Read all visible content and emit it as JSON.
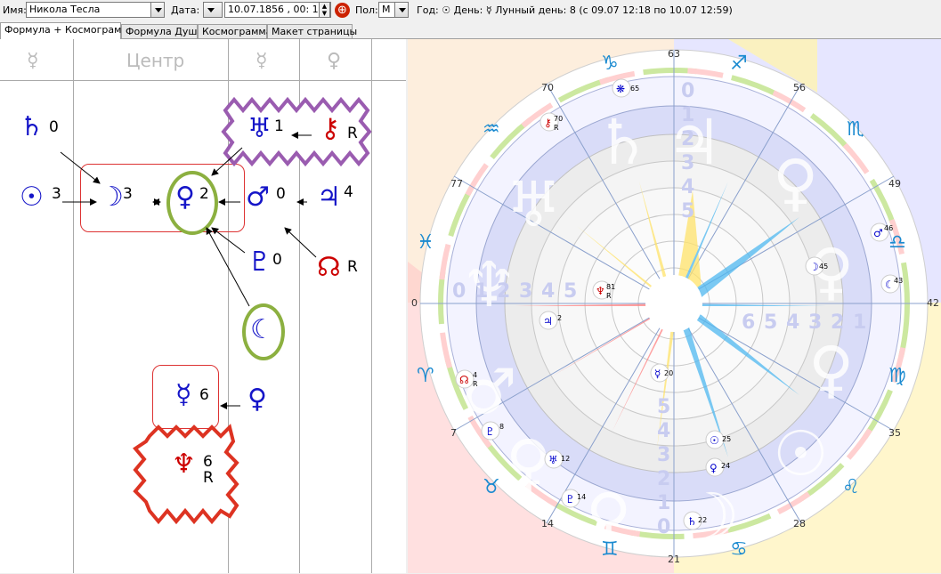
{
  "toolbar": {
    "name_label": "Имя:",
    "name_value": "Никола Тесла",
    "date_label": "Дата:",
    "date_value": "10.07.1856 , 00: 16: 17",
    "gender_label": "Пол:",
    "gender_value": "М",
    "status_text": "Год: ☉  День: ☿  Лунный день:  8 (с 09.07 12:18 по 10.07 12:59)"
  },
  "tabs": [
    "Формула + Космограмма",
    "Формула Души",
    "Космограмма",
    "Макет страницы"
  ],
  "formula": {
    "headers": [
      "☿",
      "Центр",
      "☿",
      "♀"
    ],
    "glyphs": [
      {
        "id": "saturn",
        "g": "♄",
        "n": "0"
      },
      {
        "id": "sun",
        "g": "☉",
        "n": "3"
      },
      {
        "id": "moon",
        "g": "☽",
        "n": "3"
      },
      {
        "id": "venus",
        "g": "♀",
        "n": "2"
      },
      {
        "id": "mars",
        "g": "♂",
        "n": "0"
      },
      {
        "id": "jupiter",
        "g": "♃",
        "n": "4"
      },
      {
        "id": "uranus",
        "g": "♅",
        "n": "1"
      },
      {
        "id": "chiron",
        "g": "⚷",
        "n": "R"
      },
      {
        "id": "pluto",
        "g": "♇",
        "n": "0"
      },
      {
        "id": "node",
        "g": "☊",
        "n": "R"
      },
      {
        "id": "lilith",
        "g": "☾",
        "n": ""
      },
      {
        "id": "mercury",
        "g": "☿",
        "n": "6"
      },
      {
        "id": "venus2",
        "g": "♀",
        "n": ""
      },
      {
        "id": "neptune",
        "g": "♆",
        "n": "6"
      },
      {
        "id": "neptune_r",
        "g": "",
        "n": "R"
      }
    ]
  },
  "chart": {
    "degree_labels": [
      "63",
      "56",
      "49",
      "42",
      "35",
      "28",
      "21",
      "14",
      "7",
      "0",
      "77",
      "70"
    ],
    "signs": [
      "♑",
      "♐",
      "♏",
      "♎",
      "♍",
      "♌",
      "♋",
      "♊",
      "♉",
      "♈",
      "♓",
      "♒"
    ],
    "planets": [
      {
        "g": "⚷",
        "n": "70 R",
        "c": "#cc0000"
      },
      {
        "g": "❋",
        "n": "65",
        "c": "#0000cc"
      },
      {
        "g": "♂",
        "n": "46",
        "c": "#0000cc"
      },
      {
        "g": "☽",
        "n": "45",
        "c": "#0000cc"
      },
      {
        "g": "☾",
        "n": "43",
        "c": "#0000cc"
      },
      {
        "g": "♆",
        "n": "81 R",
        "c": "#cc0000"
      },
      {
        "g": "♃",
        "n": "2",
        "c": "#0000cc"
      },
      {
        "g": "☿",
        "n": "20",
        "c": "#0000cc"
      },
      {
        "g": "☊",
        "n": "4 R",
        "c": "#cc0000"
      },
      {
        "g": "♇",
        "n": "8",
        "c": "#0000cc"
      },
      {
        "g": "♅",
        "n": "12",
        "c": "#0000cc"
      },
      {
        "g": "♇",
        "n": "14",
        "c": "#0000cc"
      },
      {
        "g": "☉",
        "n": "25",
        "c": "#0000cc"
      },
      {
        "g": "♀",
        "n": "24",
        "c": "#0000cc"
      },
      {
        "g": "♄",
        "n": "22",
        "c": "#0000cc"
      }
    ],
    "scale_digits": [
      "0",
      "1",
      "2",
      "3",
      "4",
      "5",
      "6"
    ]
  }
}
